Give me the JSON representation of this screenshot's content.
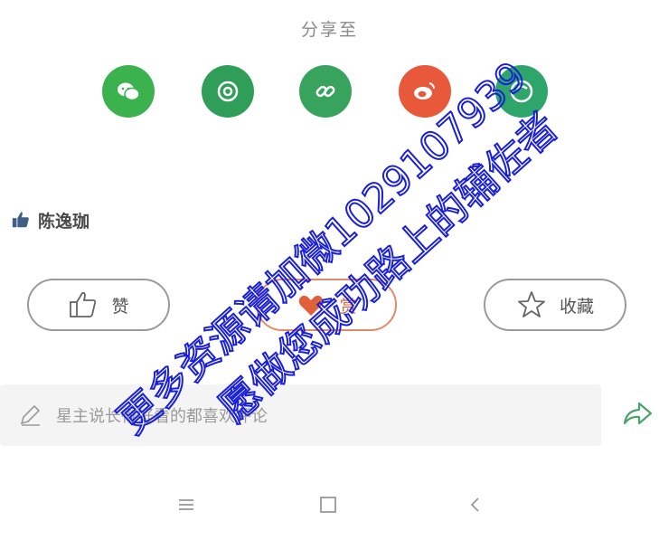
{
  "share": {
    "title": "分享至",
    "icons": [
      "wechat-icon",
      "moments-icon",
      "link-icon",
      "weibo-icon",
      "message-icon"
    ],
    "colors": {
      "wechat": "#3bb24e",
      "moments": "#2f9e58",
      "link": "#37a35c",
      "weibo": "#e8583a",
      "message": "#2ea66b"
    }
  },
  "likes": {
    "user": "陈逸珈",
    "icon": "thumbs-up-icon"
  },
  "actions": {
    "like_label": "赞",
    "reward_label": "赏",
    "favorite_label": "收藏",
    "reward_color": "#e0603a"
  },
  "comment": {
    "placeholder": "星主说长得好看的都喜欢评论",
    "pencil_icon": "pencil-icon",
    "share_icon": "share-arrow-icon"
  },
  "watermark": {
    "line1": "更多资源请加微1029107939",
    "line2": "愿做您成功路上的辅佐者",
    "color": "#1a20d8"
  }
}
